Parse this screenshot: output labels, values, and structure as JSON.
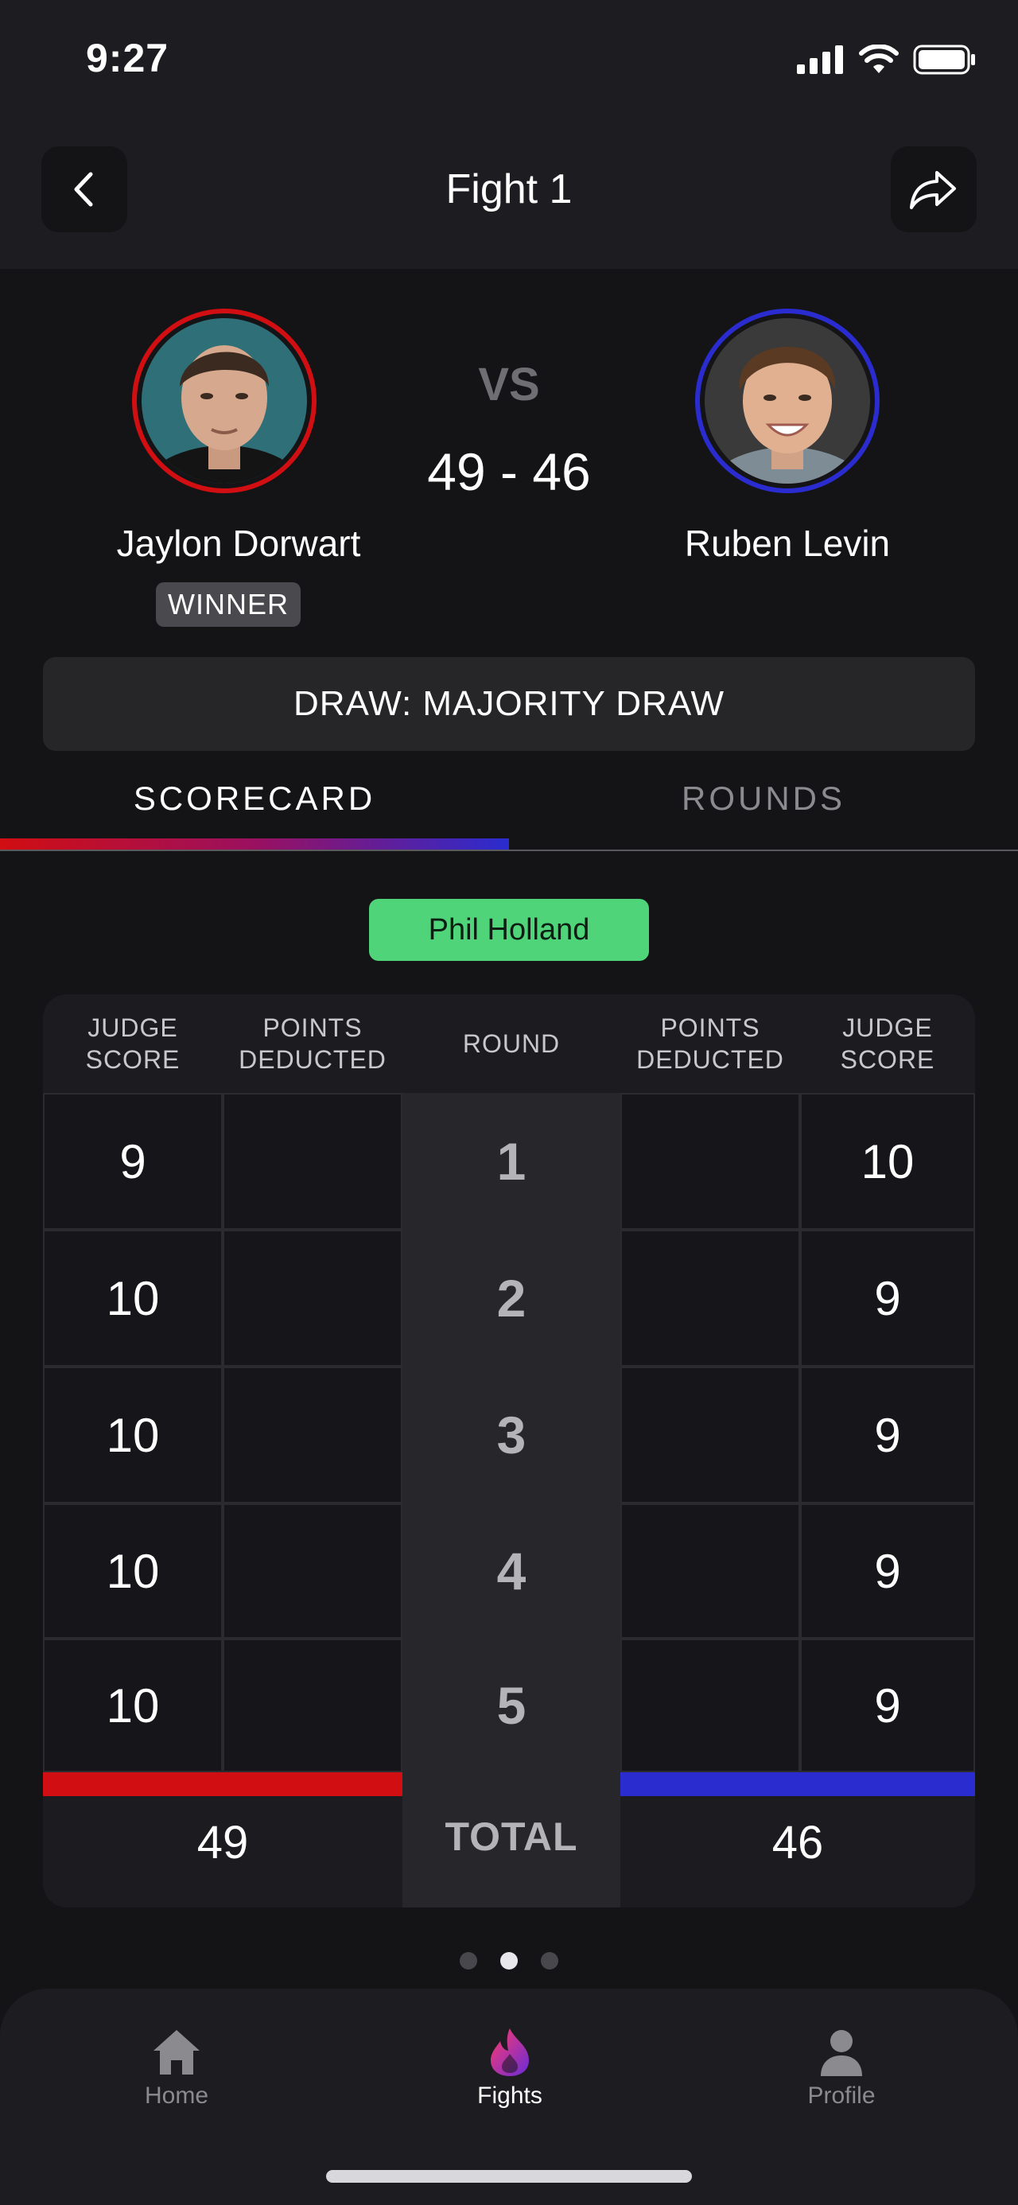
{
  "status_bar": {
    "time": "9:27"
  },
  "header": {
    "title": "Fight 1"
  },
  "fight": {
    "vs_label": "VS",
    "score": "49 - 46",
    "red_fighter": {
      "name": "Jaylon Dorwart",
      "badge": "WINNER",
      "corner_color": "#d10e12"
    },
    "blue_fighter": {
      "name": "Ruben Levin",
      "corner_color": "#2a2cd0"
    },
    "result": "DRAW: MAJORITY DRAW"
  },
  "tabs": [
    {
      "label": "SCORECARD",
      "active": true
    },
    {
      "label": "ROUNDS",
      "active": false
    }
  ],
  "judge": {
    "name": "Phil Holland",
    "chip_color": "#4fd47a"
  },
  "scorecard": {
    "headers": {
      "left_score": "JUDGE SCORE",
      "left_deducted": "POINTS DEDUCTED",
      "round": "ROUND",
      "right_deducted": "POINTS DEDUCTED",
      "right_score": "JUDGE SCORE"
    },
    "rounds": [
      {
        "round": "1",
        "red": "9",
        "blue": "10"
      },
      {
        "round": "2",
        "red": "10",
        "blue": "9"
      },
      {
        "round": "3",
        "red": "10",
        "blue": "9"
      },
      {
        "round": "4",
        "red": "10",
        "blue": "9"
      },
      {
        "round": "5",
        "red": "10",
        "blue": "9"
      }
    ],
    "total_label": "TOTAL",
    "red_total": "49",
    "blue_total": "46"
  },
  "pager": {
    "count": 3,
    "active_index": 1
  },
  "bottom_nav": [
    {
      "label": "Home",
      "icon": "home-icon",
      "active": false
    },
    {
      "label": "Fights",
      "icon": "flame-icon",
      "active": true
    },
    {
      "label": "Profile",
      "icon": "profile-icon",
      "active": false
    }
  ]
}
